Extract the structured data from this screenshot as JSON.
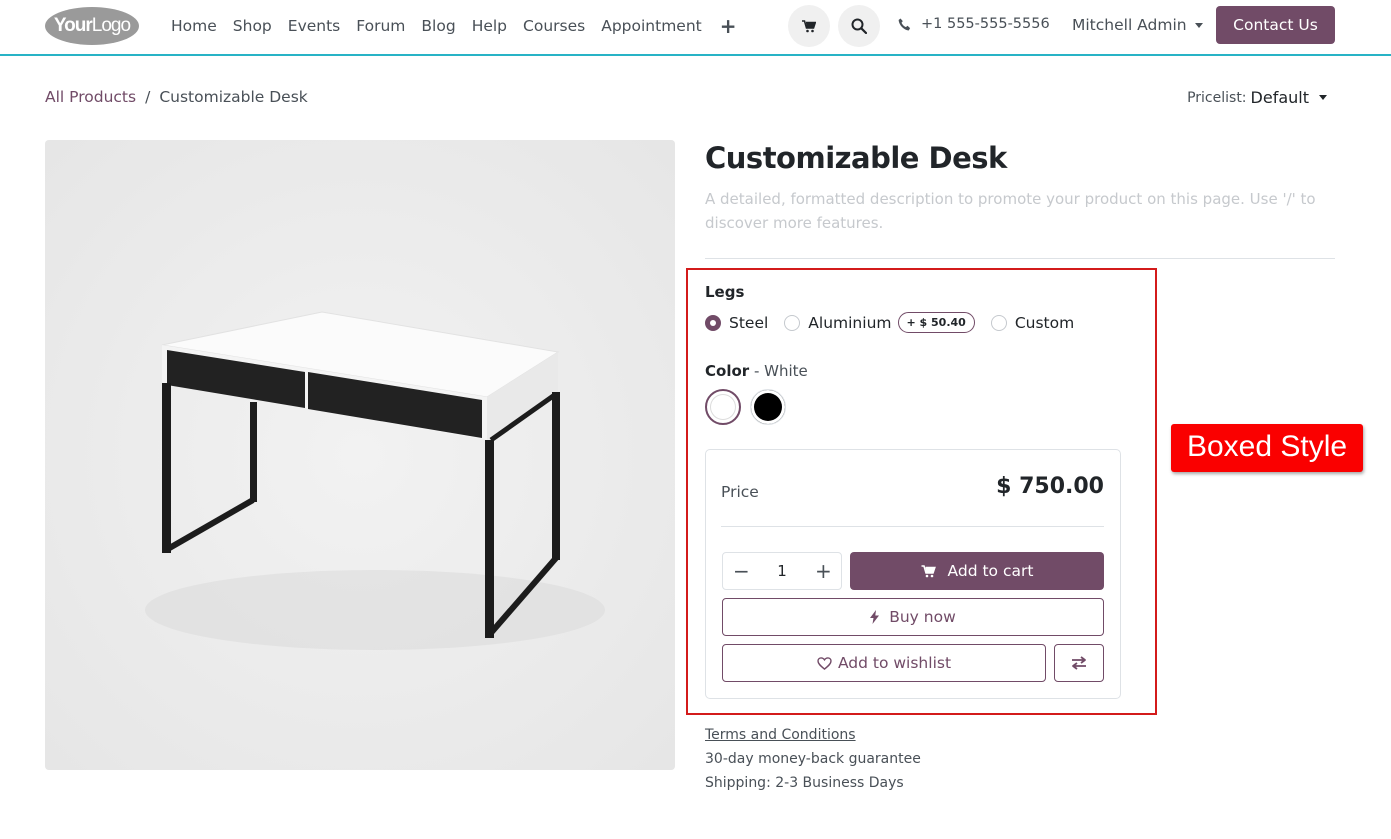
{
  "header": {
    "logo_main": "Your",
    "logo_sub": "Logo",
    "nav": [
      "Home",
      "Shop",
      "Events",
      "Forum",
      "Blog",
      "Help",
      "Courses",
      "Appointment"
    ],
    "plus": "+",
    "phone": "+1 555-555-5556",
    "user": "Mitchell Admin",
    "contact_label": "Contact Us"
  },
  "breadcrumb": {
    "parent": "All Products",
    "separator": "/",
    "current": "Customizable Desk"
  },
  "pricelist": {
    "label": "Pricelist:",
    "value": "Default"
  },
  "product": {
    "name": "Customizable Desk",
    "description": "A detailed, formatted description to promote your product on this page. Use '/' to discover more features."
  },
  "attributes": {
    "legs_label": "Legs",
    "legs_options": [
      {
        "label": "Steel",
        "checked": true
      },
      {
        "label": "Aluminium",
        "checked": false,
        "extra": "+ $ 50.40"
      },
      {
        "label": "Custom",
        "checked": false
      }
    ],
    "color_label": "Color",
    "color_separator": " - ",
    "color_value": "White",
    "color_swatches": [
      "#ffffff",
      "#000000"
    ]
  },
  "price_box": {
    "price_label": "Price",
    "price_value": "$ 750.00",
    "quantity": "1",
    "add_to_cart": "Add to cart",
    "buy_now": "Buy now",
    "add_to_wishlist": "Add to wishlist"
  },
  "annotation": {
    "callout": "Boxed Style"
  },
  "footer_info": {
    "terms": "Terms and Conditions",
    "guarantee": "30-day money-back guarantee",
    "shipping": "Shipping: 2-3 Business Days"
  },
  "colors": {
    "primary": "#714b67",
    "header_line": "#28b3c6",
    "callout": "#fa0000",
    "outline": "#d31b1b"
  }
}
